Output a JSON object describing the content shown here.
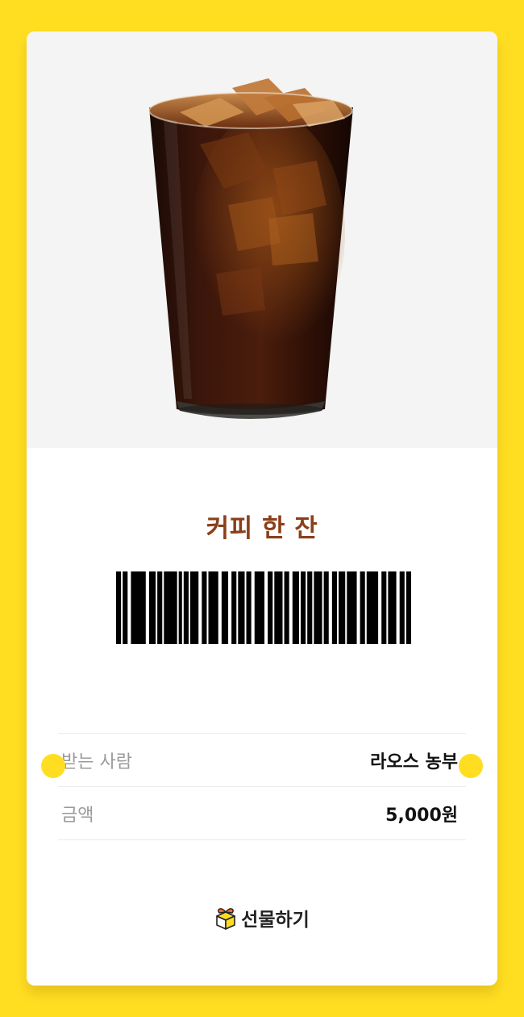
{
  "product": {
    "name": "커피 한 잔",
    "image_icon": "iced-americano-image"
  },
  "barcode": {
    "bars": [
      3,
      1,
      3,
      2,
      9,
      2,
      4,
      1,
      3,
      1,
      8,
      1,
      2,
      1,
      3,
      1,
      5,
      2,
      3,
      1,
      6,
      2,
      4,
      2,
      3,
      1,
      4,
      1,
      3,
      2,
      6,
      2,
      3,
      1,
      5,
      1,
      3,
      2,
      4,
      1,
      3,
      1,
      3,
      1,
      5,
      1,
      3,
      2,
      3,
      1,
      4,
      1,
      6,
      2,
      3,
      1,
      7,
      2,
      3,
      1,
      5,
      2,
      3,
      1,
      3
    ]
  },
  "info": {
    "recipient": {
      "label": "받는 사람",
      "value": "라오스 농부"
    },
    "amount": {
      "label": "금액",
      "value": "5,000원"
    }
  },
  "gift": {
    "label": "선물하기",
    "icon": "gift-box-icon"
  },
  "colors": {
    "background": "#ffde22",
    "title": "#8b3f1a"
  }
}
